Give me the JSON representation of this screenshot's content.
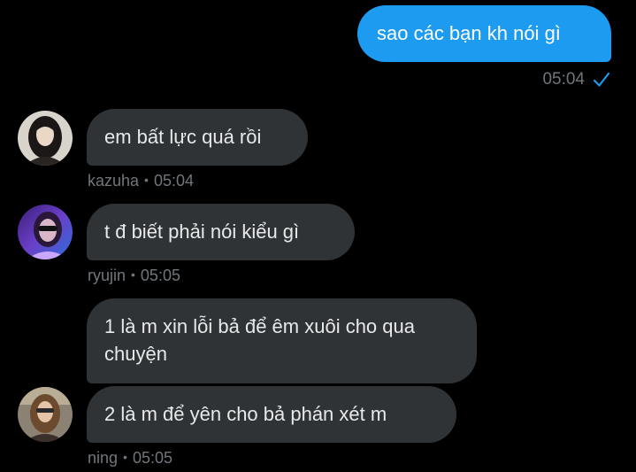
{
  "colors": {
    "background": "#000000",
    "outgoing_bubble": "#1d9bf0",
    "incoming_bubble": "#2f3336",
    "meta_text": "#71767b",
    "read_check": "#1d9bf0"
  },
  "messages": {
    "sent": {
      "text": "sao các bạn kh nói gì",
      "time": "05:04",
      "status_icon": "check-icon"
    },
    "kazuha": {
      "text": "em bất lực quá rồi",
      "sender": "kazuha",
      "time": "05:04"
    },
    "ryujin": {
      "text": "t đ biết phải nói kiểu gì",
      "sender": "ryujin",
      "time": "05:05"
    },
    "ning_1": {
      "text": "1 là m xin lỗi bả để êm xuôi cho qua chuyện"
    },
    "ning_2": {
      "text": "2 là m để yên cho bả phán xét m",
      "sender": "ning",
      "time": "05:05"
    },
    "separator": "•"
  }
}
